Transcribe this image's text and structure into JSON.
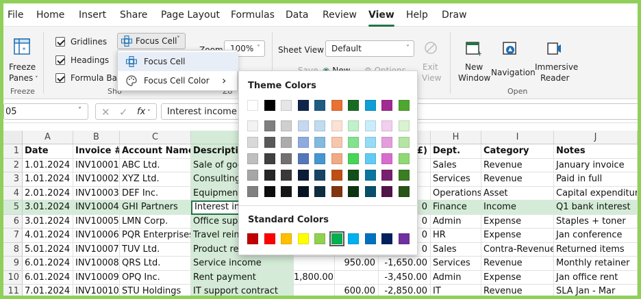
{
  "menu": {
    "tabs": [
      "File",
      "Home",
      "Insert",
      "Share",
      "Page Layout",
      "Formulas",
      "Data",
      "Review",
      "View",
      "Help",
      "Draw"
    ],
    "active": "View"
  },
  "ribbon": {
    "freeze": {
      "line1": "Freeze",
      "line2": "Panes",
      "group": "Freeze"
    },
    "show": {
      "gridlines": "Gridlines",
      "headings": "Headings",
      "formula_bar": "Formula Bar",
      "group": "Sho"
    },
    "focus_cell": {
      "label": "Focus Cell"
    },
    "zoom": {
      "label": "Zoom",
      "value": "100%",
      "group": "Zo"
    },
    "sheet_view": {
      "label": "Sheet View",
      "value": "Default",
      "save": "Save",
      "new": "New",
      "options": "Options",
      "exit_line1": "Exit",
      "exit_line2": "View"
    },
    "new_window": {
      "line1": "New",
      "line2": "Window"
    },
    "navigation": {
      "label": "Navigation"
    },
    "immersive": {
      "line1": "Immersive",
      "line2": "Reader"
    },
    "open_group": "Open"
  },
  "focus_menu": {
    "item1": "Focus Cell",
    "item2": "Focus Cell Color",
    "submenu_arrow": "›"
  },
  "color_panel": {
    "theme_title": "Theme Colors",
    "standard_title": "Standard Colors",
    "theme_top": [
      "#ffffff",
      "#000000",
      "#e7e6e6",
      "#0f2649",
      "#1f5c82",
      "#e97132",
      "#196b24",
      "#0f9ed5",
      "#a02b93",
      "#4ea72e"
    ],
    "theme_shades": [
      [
        "#f2f2f2",
        "#7f7f7f",
        "#d0cece",
        "#c6d7f0",
        "#c0dcef",
        "#fbe2d5",
        "#c1f1c8",
        "#caedfb",
        "#f2ceef",
        "#d9f2d0"
      ],
      [
        "#d9d9d9",
        "#595959",
        "#aeabab",
        "#8faadc",
        "#83bae0",
        "#f7c6ac",
        "#83e28e",
        "#95dcf7",
        "#e59edd",
        "#b4e5a2"
      ],
      [
        "#bfbfbf",
        "#404040",
        "#757070",
        "#5577b8",
        "#4597d0",
        "#f2a985",
        "#47d459",
        "#61cbf3",
        "#d86dcd",
        "#8ed973"
      ],
      [
        "#a6a6a6",
        "#262626",
        "#3a3838",
        "#0b1c36",
        "#174462",
        "#c04f15",
        "#124f1a",
        "#0b76a0",
        "#77206e",
        "#3a7d22"
      ],
      [
        "#808080",
        "#0d0d0d",
        "#171616",
        "#071324",
        "#0f2d41",
        "#80350e",
        "#0c3512",
        "#074f6a",
        "#501549",
        "#275317"
      ]
    ],
    "standard": [
      "#c00000",
      "#ff0000",
      "#ffc000",
      "#ffff00",
      "#92d050",
      "#00b050",
      "#00b0f0",
      "#0070c0",
      "#002060",
      "#7030a0"
    ],
    "standard_selected_index": 5
  },
  "formula_bar": {
    "name_box": "05",
    "fx_icon": "fx",
    "content": "Interest income"
  },
  "grid": {
    "columns": [
      "A",
      "B",
      "C",
      "D",
      "",
      "",
      "",
      "H",
      "I",
      "J"
    ],
    "rows": [
      {
        "n": "1",
        "cells": [
          "Date",
          "Invoice #",
          "Account Name",
          "Description",
          "",
          "",
          "(£)",
          "Dept.",
          "Category",
          "Notes"
        ],
        "header": true
      },
      {
        "n": "2",
        "cells": [
          "1.01.2024",
          "INV10001",
          "ABC Ltd.",
          "Sale of goo",
          "",
          "",
          "",
          "Sales",
          "Revenue",
          "January invoice"
        ]
      },
      {
        "n": "3",
        "cells": [
          "1.01.2024",
          "INV10002",
          "XYZ Ltd.",
          "Consulting",
          "",
          "",
          "",
          "Services",
          "Revenue",
          "Paid in full"
        ]
      },
      {
        "n": "4",
        "cells": [
          "2.01.2024",
          "INV10003",
          "DEF Inc.",
          "Equipment",
          "",
          "",
          "",
          "Operations",
          "Asset",
          "Capital expenditure"
        ]
      },
      {
        "n": "5",
        "cells": [
          "3.01.2024",
          "INV10004",
          "GHI Partners",
          "Interest inc",
          "",
          "",
          "0",
          "Finance",
          "Income",
          "Q1 bank interest"
        ],
        "focus": true
      },
      {
        "n": "6",
        "cells": [
          "3.01.2024",
          "INV10005",
          "LMN Corp.",
          "Office supp",
          "",
          "",
          "0",
          "Admin",
          "Expense",
          "Staples + toner"
        ]
      },
      {
        "n": "7",
        "cells": [
          "4.01.2024",
          "INV10006",
          "PQR Enterprises",
          "Travel reim",
          "",
          "",
          "0",
          "HR",
          "Expense",
          "Jan conference"
        ]
      },
      {
        "n": "8",
        "cells": [
          "5.01.2024",
          "INV10007",
          "TUV Ltd.",
          "Product ref",
          "",
          "",
          "0",
          "Sales",
          "Contra-Revenue",
          "Returned items"
        ]
      },
      {
        "n": "9",
        "cells": [
          "6.01.2024",
          "INV10008",
          "QRS Ltd.",
          "Service income",
          "",
          "950.00",
          "-1,650.00",
          "Services",
          "Revenue",
          "Monthly retainer"
        ]
      },
      {
        "n": "10",
        "cells": [
          "6.01.2024",
          "INV10009",
          "OPQ Inc.",
          "Rent payment",
          "1,800.00",
          "",
          "-3,450.00",
          "Admin",
          "Expense",
          "Jan office rent"
        ]
      },
      {
        "n": "11",
        "cells": [
          "7.01.2024",
          "INV10010",
          "STU Holdings",
          "IT support contract",
          "",
          "600.00",
          "-2,850.00",
          "IT",
          "Revenue",
          "SLA Jan - Mar"
        ]
      }
    ]
  },
  "colors": {
    "accent": "#217346",
    "focus_fill": "#d4ecd7",
    "frame": "#8fcf5a"
  }
}
